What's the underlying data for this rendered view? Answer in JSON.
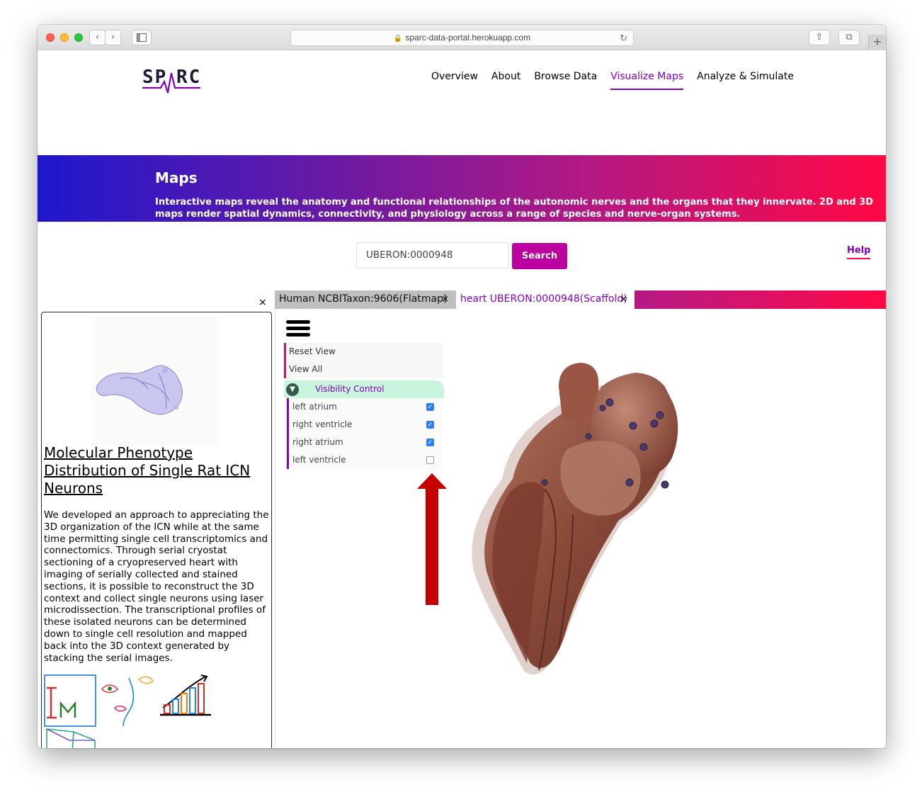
{
  "browser": {
    "url": "sparc-data-portal.herokuapp.com",
    "back_icon": "‹",
    "forward_icon": "›",
    "lock_icon": "🔒",
    "reload_icon": "↻",
    "share_icon": "⇪",
    "tabs_icon": "⧉",
    "newtab_icon": "+"
  },
  "header": {
    "logo_text": "SPARC",
    "nav": [
      "Overview",
      "About",
      "Browse Data",
      "Visualize Maps",
      "Analyze & Simulate"
    ],
    "active_nav": "Visualize Maps"
  },
  "banner": {
    "title": "Maps",
    "description": "Interactive maps reveal the anatomy and functional relationships of the autonomic nerves and the organs that they innervate. 2D and 3D maps render spatial dynamics, connectivity, and physiology across a range of species and nerve-organ systems."
  },
  "search": {
    "value": "UBERON:0000948",
    "button_label": "Search",
    "help_label": "Help"
  },
  "map_tabs": {
    "close_icon": "×",
    "tabs": [
      {
        "label": "Human NCBITaxon:9606(Flatmap)",
        "active": false
      },
      {
        "label": "heart UBERON:0000948(Scaffold)",
        "active": true
      }
    ]
  },
  "info_panel": {
    "title": "Molecular Phenotype Distribution of Single Rat ICN Neurons",
    "description": "We developed an approach to appreciating the 3D organization of the ICN while at the same time permitting single cell transcriptomics and connectomics. Through serial cryostat sectioning of a cryopreserved heart with imaging of serially collected and stained sections, it is possible to reconstruct the 3D context and collect single neurons using laser microdissection. The transcriptional profiles of these isolated neurons can be determined down to single cell resolution and mapped back into the 3D context generated by stacking the serial images."
  },
  "scaffold": {
    "menu": {
      "reset_view": "Reset View",
      "view_all": "View All",
      "visibility_control": "Visibility Control",
      "visibility_icon": "▼",
      "checkmark": "✓",
      "items": [
        {
          "label": "left atrium",
          "checked": true
        },
        {
          "label": "right ventricle",
          "checked": true
        },
        {
          "label": "right atrium",
          "checked": true
        },
        {
          "label": "left ventricle",
          "checked": false
        }
      ]
    }
  },
  "colors": {
    "accent": "#8300bf",
    "search_button": "#bc00a0",
    "arrow": "#c40000",
    "heart": "#8a4a3a"
  }
}
